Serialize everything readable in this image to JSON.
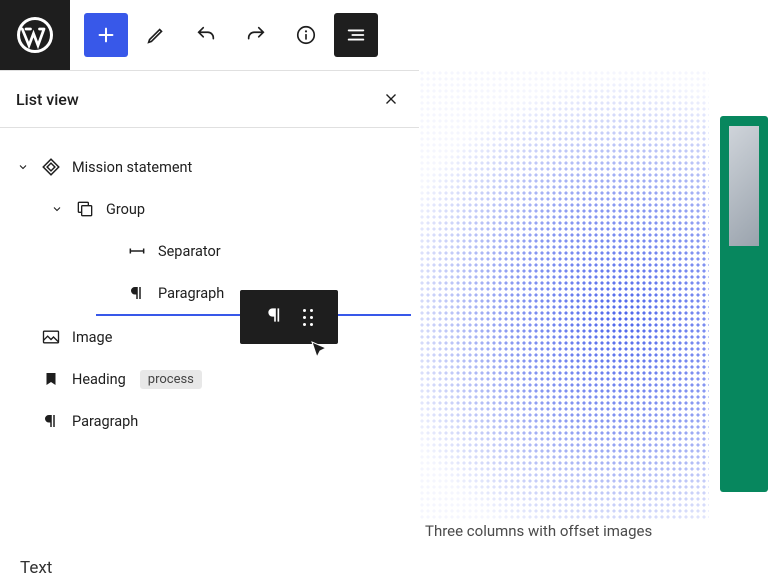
{
  "toolbar": {
    "logo_label": "WordPress",
    "add_label": "Add block",
    "edit_label": "Tools",
    "undo_label": "Undo",
    "redo_label": "Redo",
    "info_label": "Details",
    "listview_label": "List view"
  },
  "panel": {
    "title": "List view",
    "close_label": "Close"
  },
  "tree": {
    "items": [
      {
        "label": "Mission statement",
        "icon": "diamond",
        "chevron": "down",
        "depth": 0
      },
      {
        "label": "Group",
        "icon": "group",
        "chevron": "down",
        "depth": 1
      },
      {
        "label": "Separator",
        "icon": "separator",
        "chevron": "",
        "depth": 2
      },
      {
        "label": "Paragraph",
        "icon": "paragraph",
        "chevron": "",
        "depth": 2
      },
      {
        "label": "Image",
        "icon": "image",
        "chevron": "",
        "depth": 0
      },
      {
        "label": "Heading",
        "icon": "heading",
        "chevron": "",
        "depth": 0,
        "tag": "process"
      },
      {
        "label": "Paragraph",
        "icon": "paragraph",
        "chevron": "",
        "depth": 0
      }
    ]
  },
  "drag": {
    "block": "Paragraph"
  },
  "preview": {
    "caption": "Three columns with offset images"
  },
  "footer": {
    "text": "Text"
  }
}
